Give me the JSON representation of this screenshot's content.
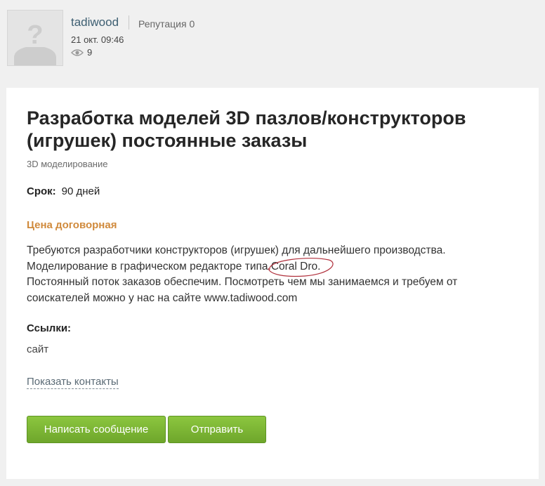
{
  "author": {
    "name": "tadiwood",
    "reputation": "Репутация 0",
    "date": "21 окт. 09:46",
    "views": "9"
  },
  "project": {
    "title": "Разработка моделей 3D пазлов/конструкторов (игрушек) постоянные заказы",
    "category": "3D моделирование",
    "term_label": "Срок:",
    "term_value": "90 дней",
    "price": "Цена договорная",
    "description": {
      "line1": "Требуются разработчики конструкторов (игрушек) для дальнейшего производства.",
      "line2_prefix": "Моделирование в графическом редакторе типа ",
      "line2_highlight": "Coral Dro.",
      "line3": "Постоянный поток заказов обеспечим. Посмотреть чем мы занимаемся и требуем от",
      "line4": "соискателей можно у нас на сайте www.tadiwood.com"
    },
    "links_label": "Ссылки:",
    "site_link": "сайт",
    "show_contacts": "Показать контакты"
  },
  "buttons": {
    "message": "Написать сообщение",
    "send": "Отправить"
  },
  "colors": {
    "accent_price": "#d08a3c",
    "button_green": "#7ab536",
    "annotation_red": "#b0303c"
  },
  "icons": {
    "avatar": "default-user-avatar-icon",
    "views": "eye-icon"
  }
}
